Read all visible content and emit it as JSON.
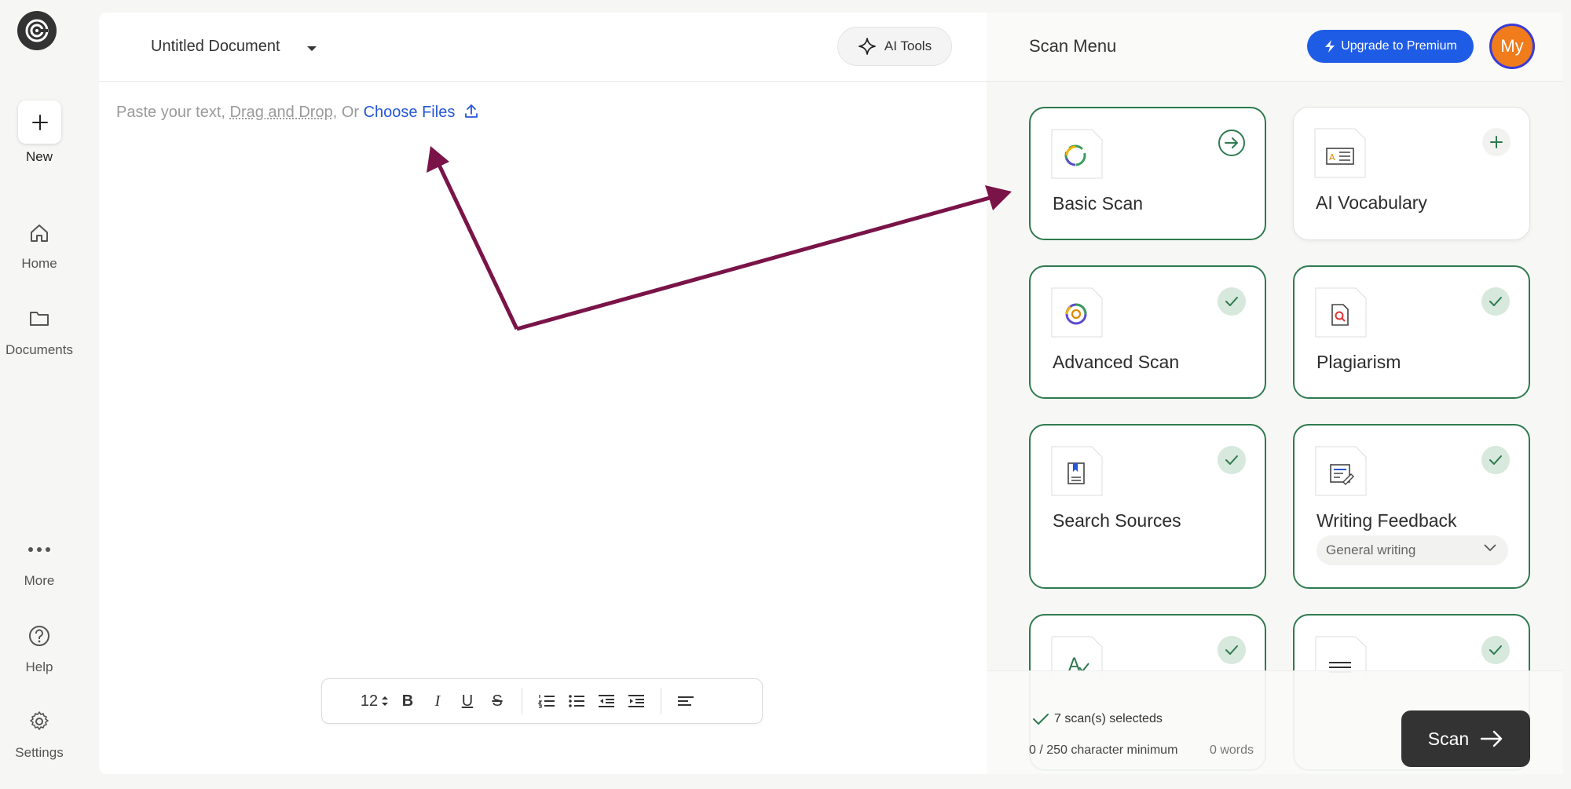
{
  "nav": {
    "new_label": "New",
    "home_label": "Home",
    "documents_label": "Documents",
    "more_label": "More",
    "help_label": "Help",
    "settings_label": "Settings"
  },
  "editor": {
    "doc_title": "Untitled Document",
    "ai_tools_label": "AI Tools",
    "placeholder_prefix": "Paste your text, ",
    "placeholder_dd": "Drag and Drop",
    "placeholder_or": ", Or ",
    "placeholder_choose": "Choose Files",
    "font_size": "12",
    "toolbar": {
      "bold": "B",
      "italic": "I",
      "underline": "U",
      "strike": "S"
    }
  },
  "scan": {
    "title": "Scan Menu",
    "upgrade_label": "Upgrade to Premium",
    "avatar_initials": "My",
    "cards": [
      {
        "label": "Basic Scan",
        "state": "arrow"
      },
      {
        "label": "AI Vocabulary",
        "state": "plus"
      },
      {
        "label": "Advanced Scan",
        "state": "check"
      },
      {
        "label": "Plagiarism",
        "state": "check"
      },
      {
        "label": "Search Sources",
        "state": "check"
      },
      {
        "label": "Writing Feedback",
        "state": "check",
        "select_value": "General writing"
      }
    ],
    "selected_text": "7 scan(s) selecteds",
    "char_text": "0 / 250 character minimum",
    "words_text": "0 words",
    "scan_button": "Scan"
  },
  "colors": {
    "accent_green": "#2f7a4f",
    "upgrade_blue": "#1f5ce6",
    "avatar_orange": "#f07c1c",
    "annotation_arrow": "#7a1448"
  }
}
